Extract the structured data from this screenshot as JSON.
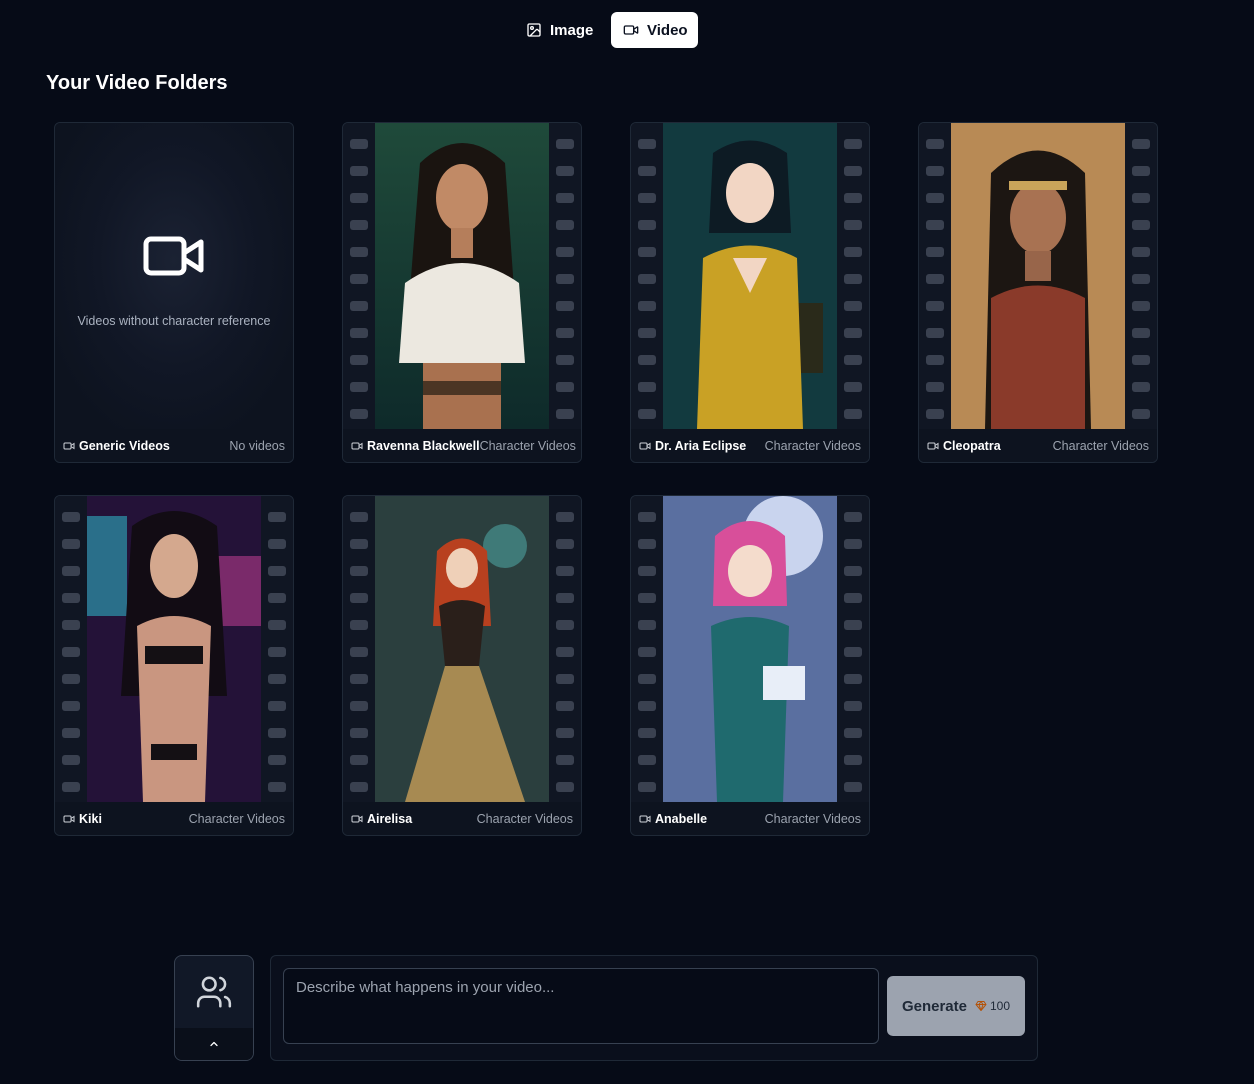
{
  "mode_toggle": {
    "image_label": "Image",
    "video_label": "Video",
    "active": "Video"
  },
  "section": {
    "title": "Your Video Folders"
  },
  "generic_folder": {
    "caption": "Videos without character reference",
    "name": "Generic Videos",
    "status": "No videos"
  },
  "folders": [
    {
      "name": "Ravenna Blackwell",
      "type": "Character Videos"
    },
    {
      "name": "Dr. Aria Eclipse",
      "type": "Character Videos"
    },
    {
      "name": "Cleopatra",
      "type": "Character Videos"
    },
    {
      "name": "Kiki",
      "type": "Character Videos"
    },
    {
      "name": "Airelisa",
      "type": "Character Videos"
    },
    {
      "name": "Anabelle",
      "type": "Character Videos"
    }
  ],
  "composer": {
    "placeholder": "Describe what happens in your video...",
    "generate_label": "Generate",
    "cost": "100"
  },
  "icons": {
    "image_tab": "image-icon",
    "video_tab": "video-icon",
    "folder": "video-icon",
    "characters": "users-icon",
    "expand": "chevron-up-icon",
    "credit": "gem-icon"
  },
  "colors": {
    "background": "#060b17",
    "card": "#0d131f",
    "active_tab": "#ffffff",
    "generate_button": "#9ca3af",
    "gem": "#f59e0b"
  }
}
